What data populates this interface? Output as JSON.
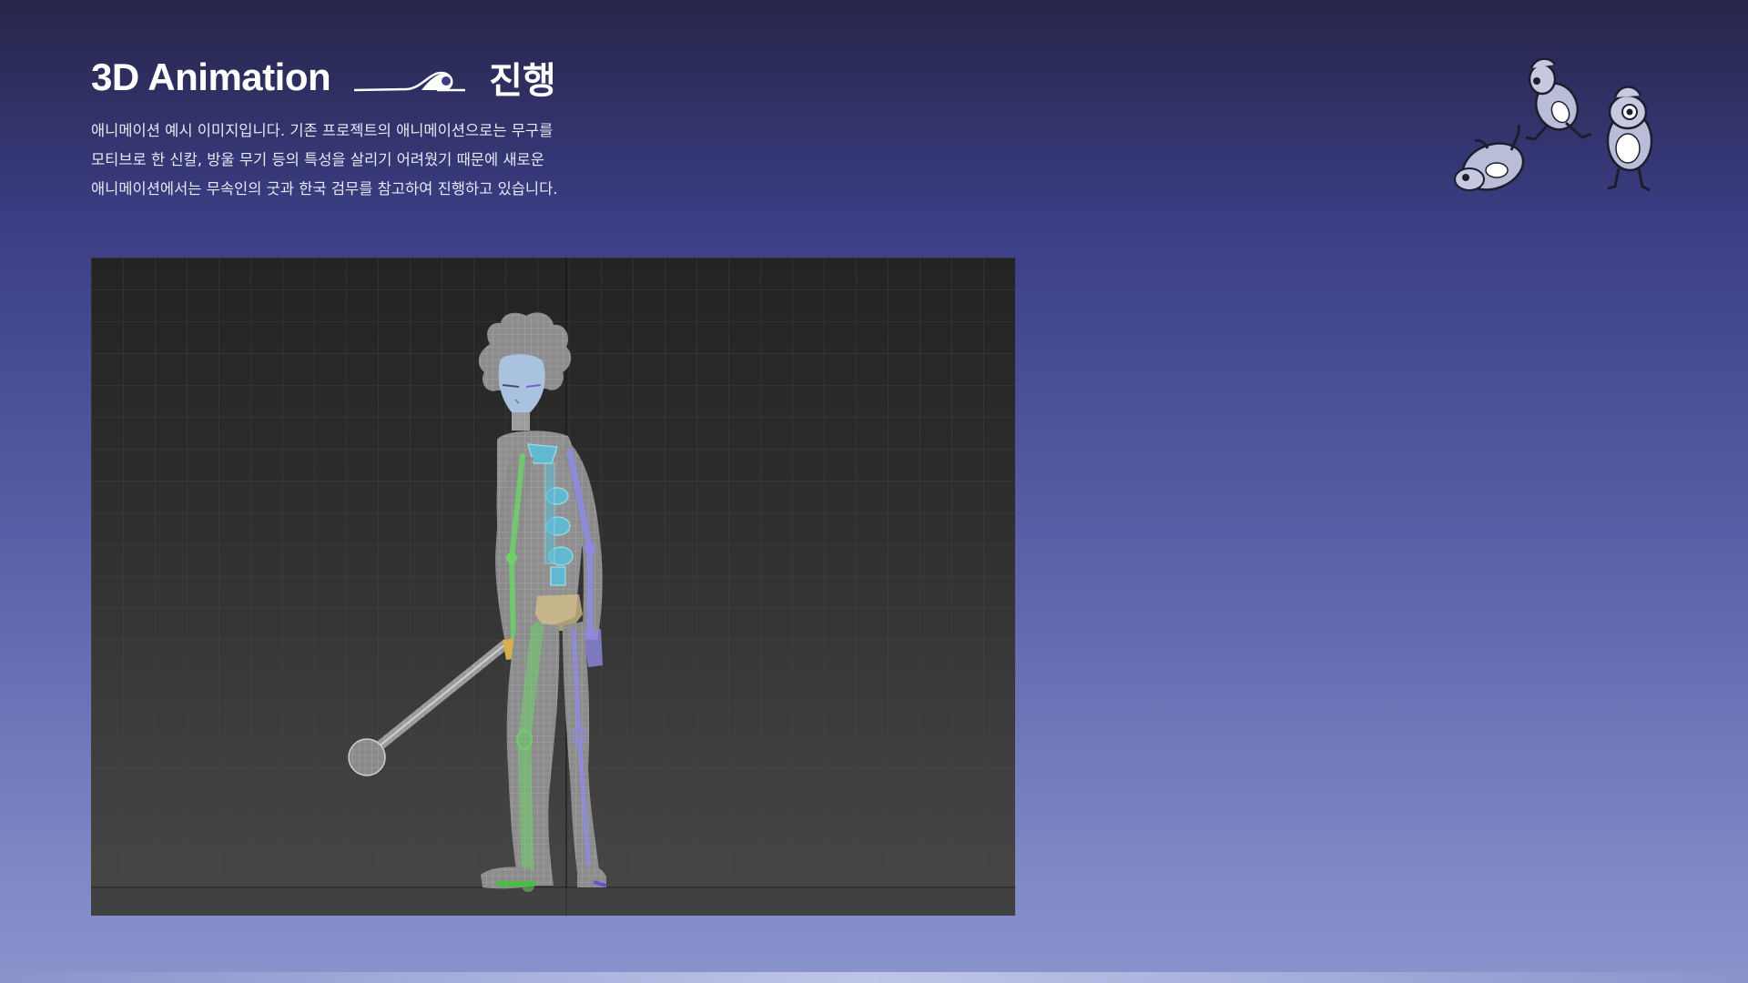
{
  "header": {
    "title_en": "3D Animation",
    "title_ko": "진행"
  },
  "description": {
    "lines": [
      "애니메이션 예시 이미지입니다. 기존 프로젝트의 애니메이션으로는 무구를",
      "모티브로 한 신칼, 방울 무기 등의 특성을 살리기 어려웠기 때문에 새로운",
      "애니메이션에서는 무속인의 굿과 한국 검무를 참고하여 진행하고 있습니다."
    ]
  },
  "colors": {
    "background_top": "#27264a",
    "background_bottom": "#8a94cc",
    "viewport_bg": "#2d2d2d",
    "bone_green": "#6fd06a",
    "bone_purple": "#8f8ae0",
    "bone_cyan": "#64c8e0",
    "mesh_grey": "#b5b5b5"
  },
  "icons": {
    "title_decoration": "wave-crest-icon",
    "mascot_group": "mascot-characters-illustration"
  }
}
